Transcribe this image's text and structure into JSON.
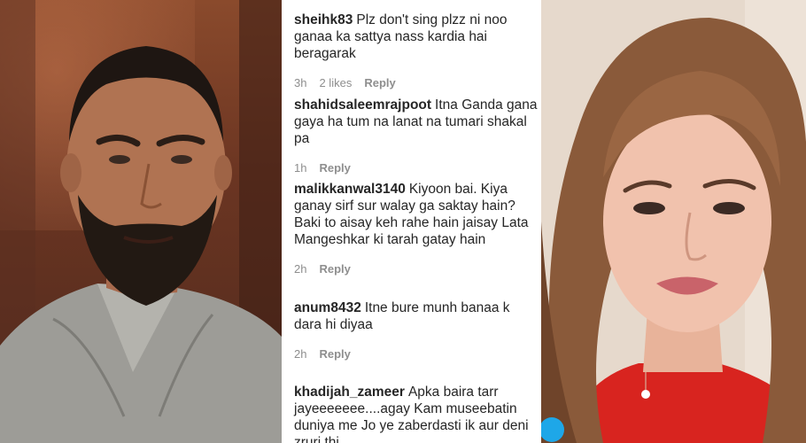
{
  "comments": [
    {
      "username": "sheihk83",
      "text": "Plz don't sing plzz ni noo ganaa ka sattya nass kardia hai beragarak",
      "time": "3h",
      "likes": "2 likes",
      "reply": "Reply"
    },
    {
      "username": "shahidsaleemrajpoot",
      "text": "Itna Ganda gana gaya ha tum na lanat na tumari shakal pa",
      "time": "1h",
      "reply": "Reply"
    },
    {
      "username": "malikkanwal3140",
      "text": "Kiyoon bai. Kiya ganay sirf sur walay ga saktay hain? Baki to aisay keh rahe hain jaisay Lata Mangeshkar ki tarah gatay hain",
      "time": "2h",
      "reply": "Reply"
    },
    {
      "username": "anum8432",
      "text": "Itne bure munh banaa k dara hi diyaa",
      "time": "2h",
      "reply": "Reply"
    },
    {
      "username": "khadijah_zameer",
      "text": "Apka baira tarr jayeeeeeee....agay Kam museebatin duniya me Jo ye zaberdasti ik aur deni zruri thi",
      "time": "",
      "reply": ""
    }
  ],
  "colors": {
    "text": "#262626",
    "meta": "#8e8e8e",
    "background": "#ffffff"
  }
}
